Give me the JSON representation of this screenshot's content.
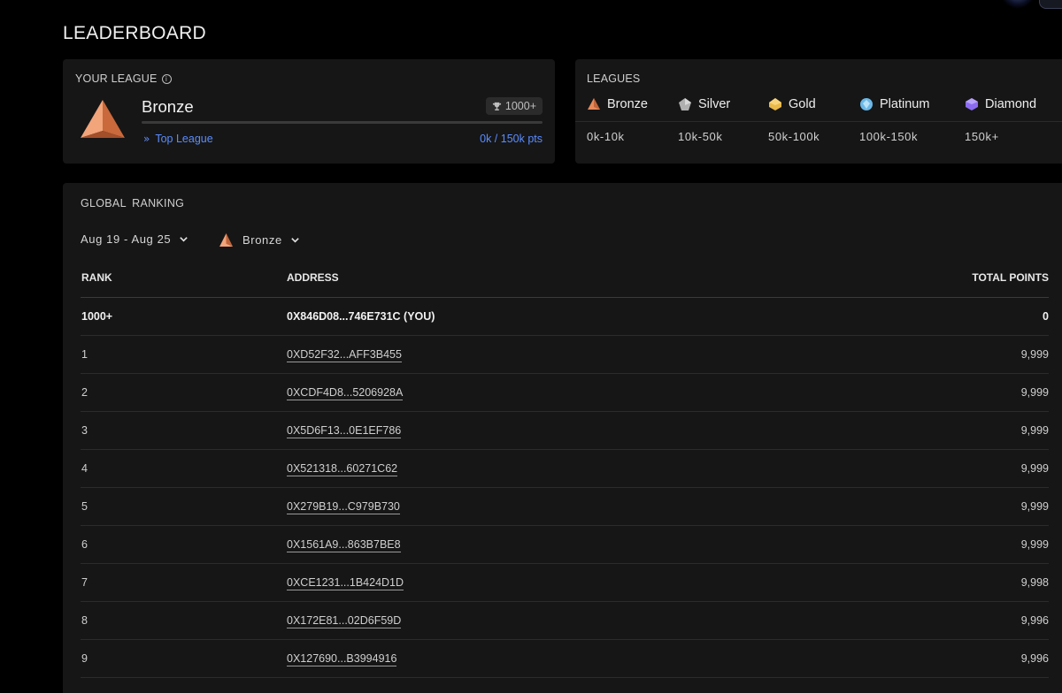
{
  "page": {
    "title": "LEADERBOARD"
  },
  "your_league": {
    "header": "YOUR LEAGUE",
    "name": "Bronze",
    "badge": "1000+",
    "progress_percent": 0,
    "top_link": "Top League",
    "points": "0k / 150k pts"
  },
  "leagues": {
    "header": "LEAGUES",
    "items": [
      {
        "name": "Bronze",
        "range": "0k-10k",
        "color": "#e8895a",
        "icon": "bronze-icon"
      },
      {
        "name": "Silver",
        "range": "10k-50k",
        "color": "#b0b0b0",
        "icon": "silver-icon"
      },
      {
        "name": "Gold",
        "range": "50k-100k",
        "color": "#e9b949",
        "icon": "gold-icon"
      },
      {
        "name": "Platinum",
        "range": "100k-150k",
        "color": "#6cb8e8",
        "icon": "platinum-icon"
      },
      {
        "name": "Diamond",
        "range": "150k+",
        "color": "#8b6cf0",
        "icon": "diamond-icon"
      }
    ]
  },
  "ranking": {
    "header": "GLOBAL  RANKING",
    "date_filter": "Aug 19 - Aug 25",
    "league_filter": "Bronze",
    "columns": {
      "rank": "RANK",
      "address": "ADDRESS",
      "points": "TOTAL POINTS"
    },
    "you": {
      "rank": "1000+",
      "address": "0X846D08...746E731C (YOU)",
      "points": "0"
    },
    "rows": [
      {
        "rank": "1",
        "address": "0XD52F32...AFF3B455",
        "points": "9,999"
      },
      {
        "rank": "2",
        "address": "0XCDF4D8...5206928A",
        "points": "9,999"
      },
      {
        "rank": "3",
        "address": "0X5D6F13...0E1EF786",
        "points": "9,999"
      },
      {
        "rank": "4",
        "address": "0X521318...60271C62",
        "points": "9,999"
      },
      {
        "rank": "5",
        "address": "0X279B19...C979B730",
        "points": "9,999"
      },
      {
        "rank": "6",
        "address": "0X1561A9...863B7BE8",
        "points": "9,999"
      },
      {
        "rank": "7",
        "address": "0XCE1231...1B424D1D",
        "points": "9,998"
      },
      {
        "rank": "8",
        "address": "0X172E81...02D6F59D",
        "points": "9,996"
      },
      {
        "rank": "9",
        "address": "0X127690...B3994916",
        "points": "9,996"
      }
    ]
  }
}
